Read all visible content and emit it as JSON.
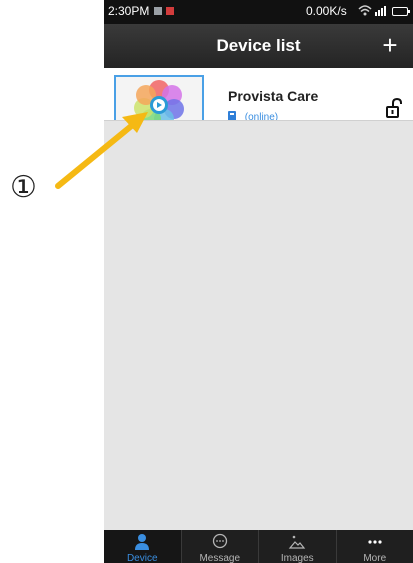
{
  "statusbar": {
    "time": "2:30PM",
    "network_speed": "0.00K/s",
    "wifi_icon": "wifi-icon",
    "signal_icon": "signal-icon",
    "battery_icon": "battery-icon"
  },
  "header": {
    "title": "Device list",
    "add_label": "+"
  },
  "devices": [
    {
      "name": "Provista Care",
      "status": "(online)",
      "status_color": "#3a8ee0",
      "lock_icon": "unlocked-padlock-icon"
    }
  ],
  "tabs": [
    {
      "label": "Device",
      "icon": "person-icon",
      "active": true
    },
    {
      "label": "Message",
      "icon": "chat-bubble-icon",
      "active": false
    },
    {
      "label": "Images",
      "icon": "image-icon",
      "active": false
    },
    {
      "label": "More",
      "icon": "more-dots-icon",
      "active": false
    }
  ],
  "annotation": {
    "callout": "①",
    "arrow_color": "#f5b914"
  },
  "colors": {
    "accent": "#3a8ee0",
    "thumbnail_border": "#4aa0e6",
    "titlebar": "#2d2d2d",
    "tabbar": "#1f1f1f",
    "background": "#e5e5e5"
  }
}
